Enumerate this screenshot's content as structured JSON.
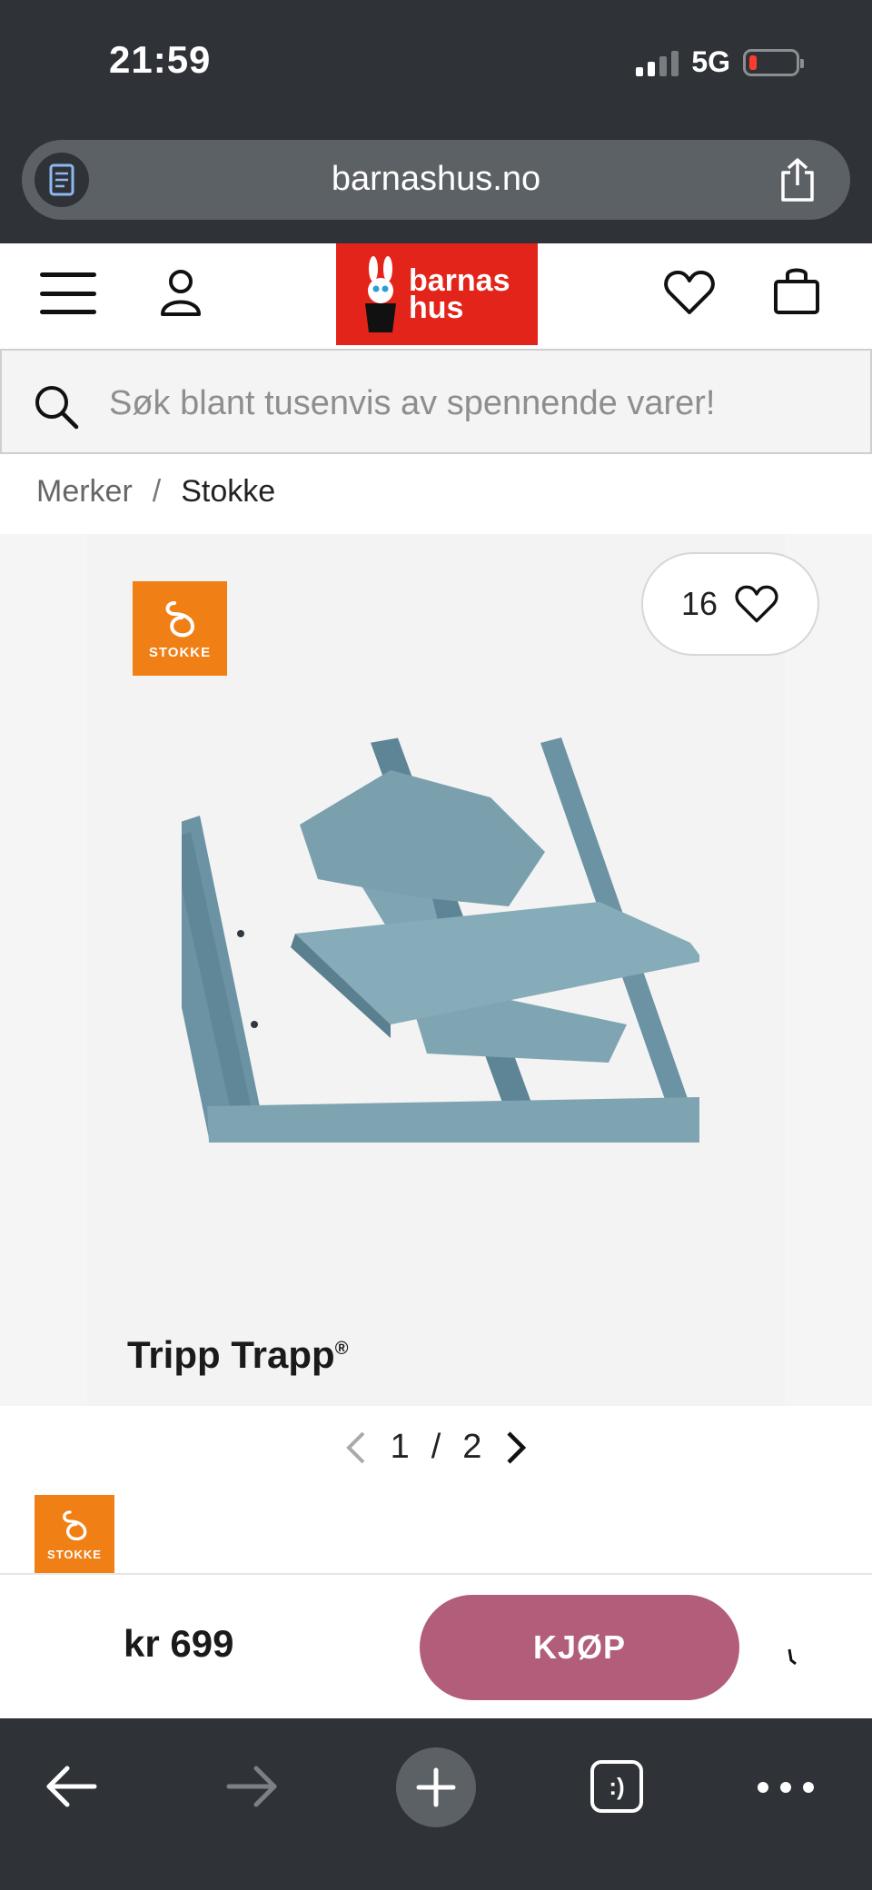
{
  "status_bar": {
    "time": "21:59",
    "network": "5G"
  },
  "browser": {
    "url": "barnashus.no"
  },
  "header": {
    "logo_line1": "barnas",
    "logo_line2": "hus"
  },
  "search": {
    "placeholder": "Søk blant tusenvis av spennende varer!"
  },
  "breadcrumb": {
    "items": [
      "Merker",
      "Stokke"
    ],
    "separator": "/"
  },
  "product": {
    "brand": "STOKKE",
    "wishlist_count": "16",
    "name": "Tripp Trapp",
    "name_mark": "®",
    "image_index": "1",
    "image_total": "2",
    "pager_sep": "/",
    "price": "kr 699",
    "buy_label": "KJØP"
  },
  "colors": {
    "browser_chrome": "#2f3337",
    "logo_red": "#e3241b",
    "brand_orange": "#f08015",
    "buy_button": "#b25d79",
    "chair_blue": "#6f97a6"
  }
}
